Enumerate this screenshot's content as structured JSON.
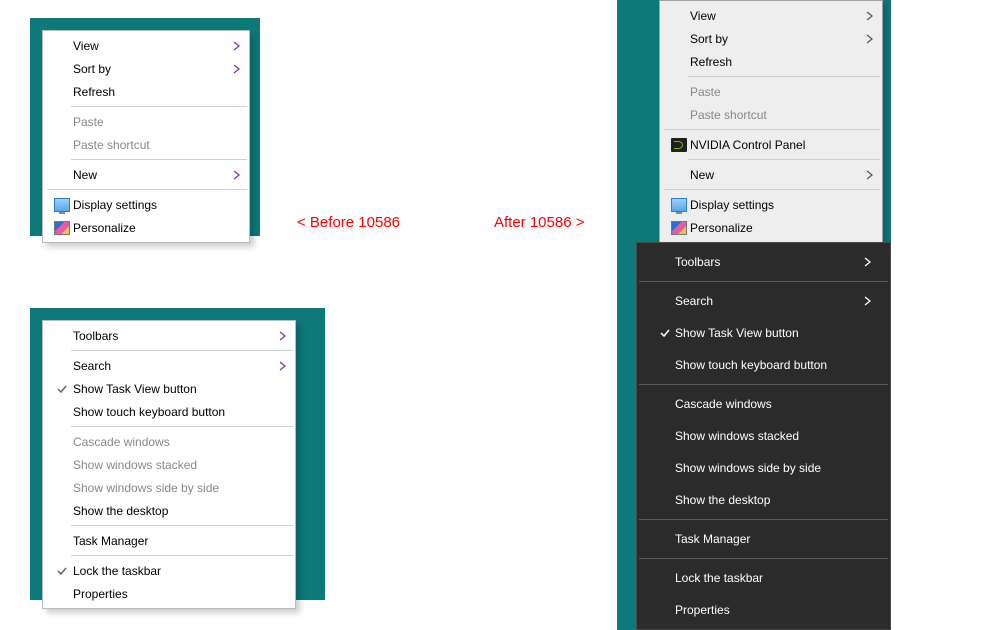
{
  "annotations": {
    "before": "< Before 10586",
    "after": "After 10586 >"
  },
  "desktop_menu_light": {
    "view": "View",
    "sort_by": "Sort by",
    "refresh": "Refresh",
    "paste": "Paste",
    "paste_shortcut": "Paste shortcut",
    "new": "New",
    "display_settings": "Display settings",
    "personalize": "Personalize"
  },
  "desktop_menu_light2": {
    "view": "View",
    "sort_by": "Sort by",
    "refresh": "Refresh",
    "paste": "Paste",
    "paste_shortcut": "Paste shortcut",
    "nvidia": "NVIDIA Control Panel",
    "new": "New",
    "display_settings": "Display settings",
    "personalize": "Personalize"
  },
  "taskbar_menu_light": {
    "toolbars": "Toolbars",
    "search": "Search",
    "show_task_view": "Show Task View button",
    "show_touch_kb": "Show touch keyboard button",
    "cascade": "Cascade windows",
    "stacked": "Show windows stacked",
    "side_by_side": "Show windows side by side",
    "show_desktop": "Show the desktop",
    "task_manager": "Task Manager",
    "lock_taskbar": "Lock the taskbar",
    "properties": "Properties"
  },
  "taskbar_menu_dark": {
    "toolbars": "Toolbars",
    "search": "Search",
    "show_task_view": "Show Task View button",
    "show_touch_kb": "Show touch keyboard button",
    "cascade": "Cascade windows",
    "stacked": "Show windows stacked",
    "side_by_side": "Show windows side by side",
    "show_desktop": "Show the desktop",
    "task_manager": "Task Manager",
    "lock_taskbar": "Lock the taskbar",
    "properties": "Properties"
  }
}
